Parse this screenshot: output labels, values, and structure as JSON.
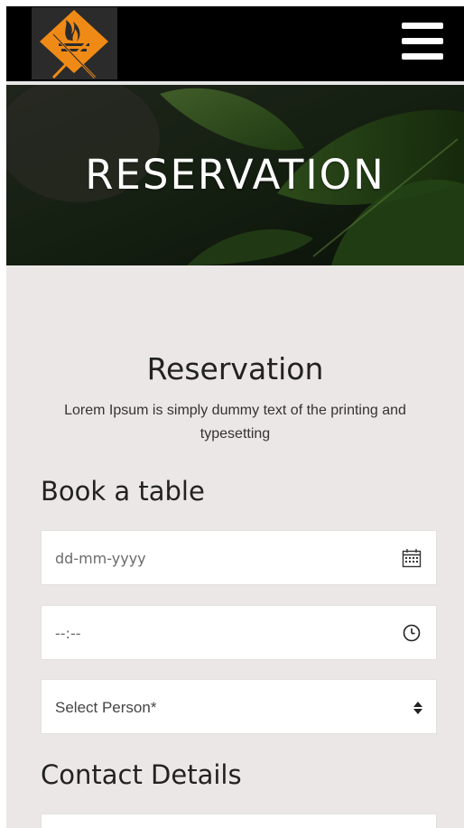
{
  "header": {
    "logo_icon": "grill-fire-utensils-icon",
    "logo_colors": {
      "accent": "#f08a16",
      "background": "#2b2b2b"
    },
    "menu_icon": "hamburger-menu-icon"
  },
  "hero": {
    "title": "RESERVATION"
  },
  "reservation": {
    "title": "Reservation",
    "description": "Lorem Ipsum is simply dummy text of the printing and typesetting"
  },
  "booking": {
    "heading": "Book a table",
    "date": {
      "placeholder": "dd-mm-yyyy",
      "icon": "calendar-icon"
    },
    "time": {
      "placeholder": "--:--",
      "icon": "clock-icon"
    },
    "person": {
      "selected": "Select Person*",
      "icon": "sort-arrows-icon"
    }
  },
  "contact": {
    "heading": "Contact Details"
  },
  "colors": {
    "page_background": "#ece7e7",
    "header_background": "#000000",
    "field_background": "#ffffff",
    "text_dark": "#222222"
  }
}
